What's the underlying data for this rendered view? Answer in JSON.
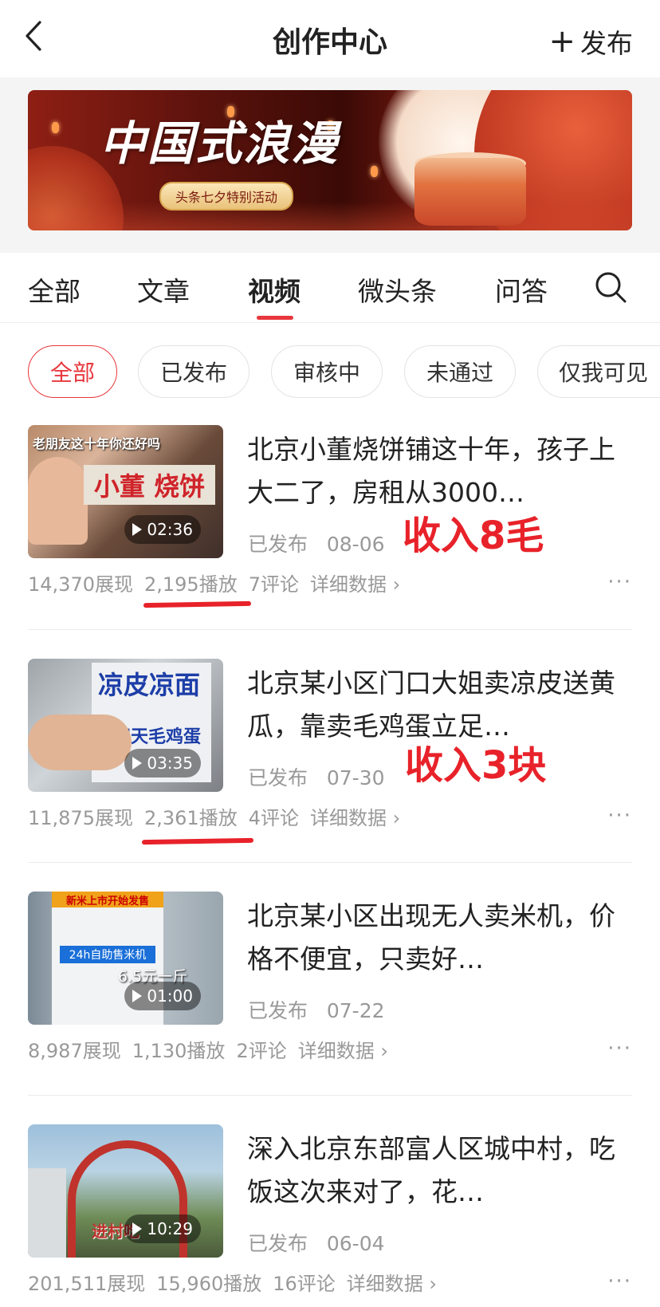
{
  "header": {
    "title": "创作中心",
    "publish_label": "发布"
  },
  "banner": {
    "title": "中国式浪漫",
    "subtitle": "头条七夕特别活动"
  },
  "tabs": [
    {
      "label": "全部",
      "active": false
    },
    {
      "label": "文章",
      "active": false
    },
    {
      "label": "视频",
      "active": true
    },
    {
      "label": "微头条",
      "active": false
    },
    {
      "label": "问答",
      "active": false
    }
  ],
  "filters": [
    {
      "label": "全部",
      "active": true
    },
    {
      "label": "已发布",
      "active": false
    },
    {
      "label": "审核中",
      "active": false
    },
    {
      "label": "未通过",
      "active": false
    },
    {
      "label": "仅我可见",
      "active": false
    }
  ],
  "videos": [
    {
      "title": "北京小董烧饼铺这十年，孩子上大二了，房租从3000…",
      "status": "已发布",
      "date": "08-06",
      "duration": "02:36",
      "impressions": "14,370展现",
      "plays": "2,195播放",
      "comments": "7评论",
      "detail": "详细数据",
      "thumb_caption": "老朋友这十年你还好吗",
      "thumb_sign": "小董 烧饼",
      "annotation": "收入8毛"
    },
    {
      "title": "北京某小区门口大姐卖凉皮送黄瓜，靠卖毛鸡蛋立足…",
      "status": "已发布",
      "date": "07-30",
      "duration": "03:35",
      "impressions": "11,875展现",
      "plays": "2,361播放",
      "comments": "4评论",
      "detail": "详细数据",
      "thumb_sign_1": "凉皮凉面",
      "thumb_sign_2": "十四天毛鸡蛋",
      "annotation": "收入3块"
    },
    {
      "title": "北京某小区出现无人卖米机，价格不便宜，只卖好…",
      "status": "已发布",
      "date": "07-22",
      "duration": "01:00",
      "impressions": "8,987展现",
      "plays": "1,130播放",
      "comments": "2评论",
      "detail": "详细数据",
      "thumb_top": "新米上市开始发售",
      "thumb_blue": "24h自助售米机",
      "thumb_price": "6.5元一斤"
    },
    {
      "title": "深入北京东部富人区城中村，吃饭这次来对了，花…",
      "status": "已发布",
      "date": "06-04",
      "duration": "10:29",
      "impressions": "201,511展现",
      "plays": "15,960播放",
      "comments": "16评论",
      "detail": "详细数据",
      "thumb_sign": "进村吃"
    }
  ],
  "more_label": "···",
  "colors": {
    "accent": "#e8373c",
    "annotation": "#e8222a",
    "muted": "#999999"
  },
  "icons": {
    "back": "chevron-left-icon",
    "search": "search-icon",
    "play": "play-icon"
  }
}
